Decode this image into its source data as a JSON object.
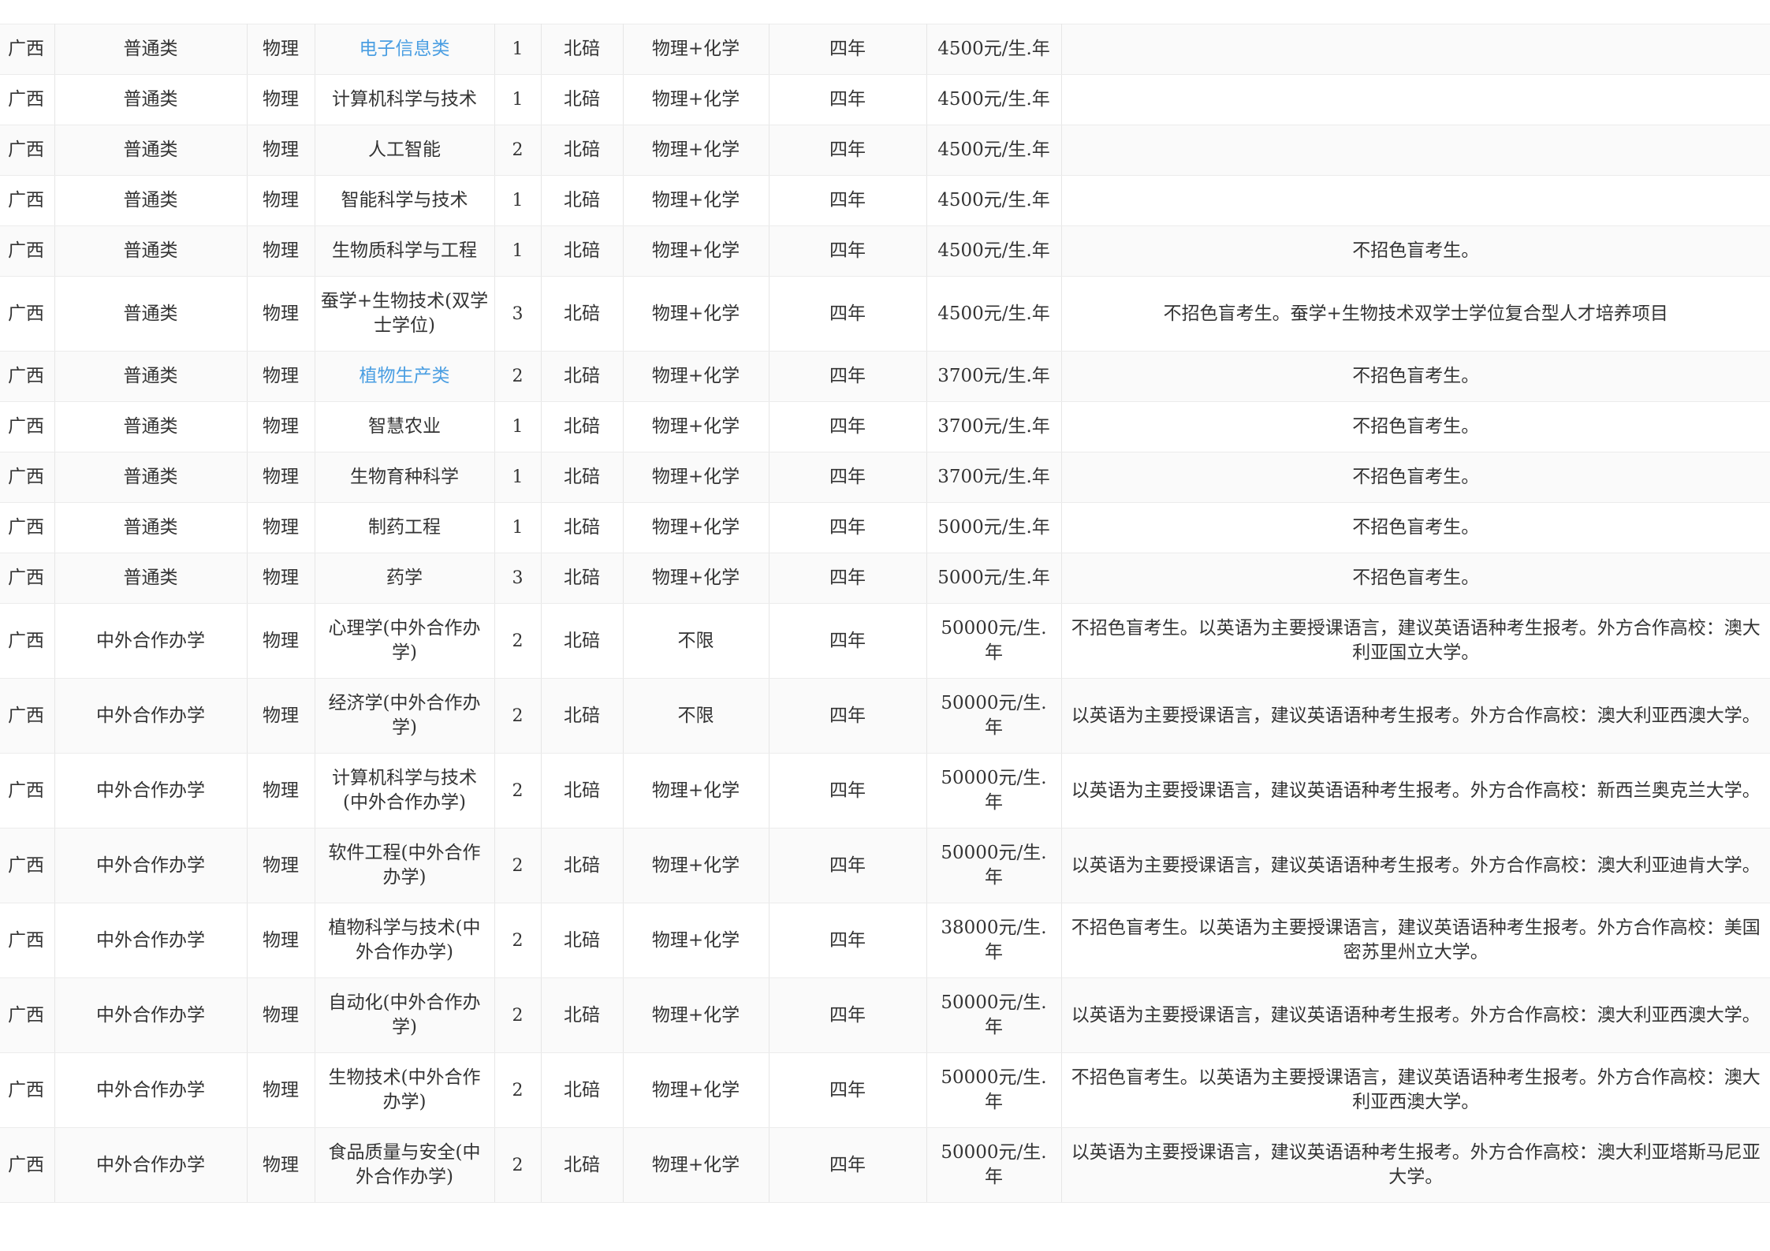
{
  "colors": {
    "link": "#4a9ee2",
    "text": "#333333",
    "row_alt": "#fafafa",
    "border": "#ececec"
  },
  "rows": [
    {
      "province": "广西",
      "type": "普通类",
      "subject": "物理",
      "major": "电子信息类",
      "major_link": true,
      "count": "1",
      "campus": "北碚",
      "req": "物理+化学",
      "years": "四年",
      "fee": "4500元/生.年",
      "note": ""
    },
    {
      "province": "广西",
      "type": "普通类",
      "subject": "物理",
      "major": "计算机科学与技术",
      "major_link": false,
      "count": "1",
      "campus": "北碚",
      "req": "物理+化学",
      "years": "四年",
      "fee": "4500元/生.年",
      "note": ""
    },
    {
      "province": "广西",
      "type": "普通类",
      "subject": "物理",
      "major": "人工智能",
      "major_link": false,
      "count": "2",
      "campus": "北碚",
      "req": "物理+化学",
      "years": "四年",
      "fee": "4500元/生.年",
      "note": ""
    },
    {
      "province": "广西",
      "type": "普通类",
      "subject": "物理",
      "major": "智能科学与技术",
      "major_link": false,
      "count": "1",
      "campus": "北碚",
      "req": "物理+化学",
      "years": "四年",
      "fee": "4500元/生.年",
      "note": ""
    },
    {
      "province": "广西",
      "type": "普通类",
      "subject": "物理",
      "major": "生物质科学与工程",
      "major_link": false,
      "count": "1",
      "campus": "北碚",
      "req": "物理+化学",
      "years": "四年",
      "fee": "4500元/生.年",
      "note": "不招色盲考生。"
    },
    {
      "province": "广西",
      "type": "普通类",
      "subject": "物理",
      "major": "蚕学+生物技术(双学士学位)",
      "major_link": false,
      "count": "3",
      "campus": "北碚",
      "req": "物理+化学",
      "years": "四年",
      "fee": "4500元/生.年",
      "note": "不招色盲考生。蚕学+生物技术双学士学位复合型人才培养项目",
      "tall": true
    },
    {
      "province": "广西",
      "type": "普通类",
      "subject": "物理",
      "major": "植物生产类",
      "major_link": true,
      "count": "2",
      "campus": "北碚",
      "req": "物理+化学",
      "years": "四年",
      "fee": "3700元/生.年",
      "note": "不招色盲考生。"
    },
    {
      "province": "广西",
      "type": "普通类",
      "subject": "物理",
      "major": "智慧农业",
      "major_link": false,
      "count": "1",
      "campus": "北碚",
      "req": "物理+化学",
      "years": "四年",
      "fee": "3700元/生.年",
      "note": "不招色盲考生。"
    },
    {
      "province": "广西",
      "type": "普通类",
      "subject": "物理",
      "major": "生物育种科学",
      "major_link": false,
      "count": "1",
      "campus": "北碚",
      "req": "物理+化学",
      "years": "四年",
      "fee": "3700元/生.年",
      "note": "不招色盲考生。"
    },
    {
      "province": "广西",
      "type": "普通类",
      "subject": "物理",
      "major": "制药工程",
      "major_link": false,
      "count": "1",
      "campus": "北碚",
      "req": "物理+化学",
      "years": "四年",
      "fee": "5000元/生.年",
      "note": "不招色盲考生。"
    },
    {
      "province": "广西",
      "type": "普通类",
      "subject": "物理",
      "major": "药学",
      "major_link": false,
      "count": "3",
      "campus": "北碚",
      "req": "物理+化学",
      "years": "四年",
      "fee": "5000元/生.年",
      "note": "不招色盲考生。"
    },
    {
      "province": "广西",
      "type": "中外合作办学",
      "subject": "物理",
      "major": "心理学(中外合作办学)",
      "major_link": false,
      "count": "2",
      "campus": "北碚",
      "req": "不限",
      "years": "四年",
      "fee": "50000元/生.年",
      "note": "不招色盲考生。以英语为主要授课语言，建议英语语种考生报考。外方合作高校：澳大利亚国立大学。",
      "tall": true
    },
    {
      "province": "广西",
      "type": "中外合作办学",
      "subject": "物理",
      "major": "经济学(中外合作办学)",
      "major_link": false,
      "count": "2",
      "campus": "北碚",
      "req": "不限",
      "years": "四年",
      "fee": "50000元/生.年",
      "note": "以英语为主要授课语言，建议英语语种考生报考。外方合作高校：澳大利亚西澳大学。",
      "tall": true
    },
    {
      "province": "广西",
      "type": "中外合作办学",
      "subject": "物理",
      "major": "计算机科学与技术(中外合作办学)",
      "major_link": false,
      "count": "2",
      "campus": "北碚",
      "req": "物理+化学",
      "years": "四年",
      "fee": "50000元/生.年",
      "note": "以英语为主要授课语言，建议英语语种考生报考。外方合作高校：新西兰奥克兰大学。",
      "tall": true
    },
    {
      "province": "广西",
      "type": "中外合作办学",
      "subject": "物理",
      "major": "软件工程(中外合作办学)",
      "major_link": false,
      "count": "2",
      "campus": "北碚",
      "req": "物理+化学",
      "years": "四年",
      "fee": "50000元/生.年",
      "note": "以英语为主要授课语言，建议英语语种考生报考。外方合作高校：澳大利亚迪肯大学。",
      "tall": true
    },
    {
      "province": "广西",
      "type": "中外合作办学",
      "subject": "物理",
      "major": "植物科学与技术(中外合作办学)",
      "major_link": false,
      "count": "2",
      "campus": "北碚",
      "req": "物理+化学",
      "years": "四年",
      "fee": "38000元/生.年",
      "note": "不招色盲考生。以英语为主要授课语言，建议英语语种考生报考。外方合作高校：美国密苏里州立大学。",
      "tall": true
    },
    {
      "province": "广西",
      "type": "中外合作办学",
      "subject": "物理",
      "major": "自动化(中外合作办学)",
      "major_link": false,
      "count": "2",
      "campus": "北碚",
      "req": "物理+化学",
      "years": "四年",
      "fee": "50000元/生.年",
      "note": "以英语为主要授课语言，建议英语语种考生报考。外方合作高校：澳大利亚西澳大学。",
      "tall": true
    },
    {
      "province": "广西",
      "type": "中外合作办学",
      "subject": "物理",
      "major": "生物技术(中外合作办学)",
      "major_link": false,
      "count": "2",
      "campus": "北碚",
      "req": "物理+化学",
      "years": "四年",
      "fee": "50000元/生.年",
      "note": "不招色盲考生。以英语为主要授课语言，建议英语语种考生报考。外方合作高校：澳大利亚西澳大学。",
      "tall": true
    },
    {
      "province": "广西",
      "type": "中外合作办学",
      "subject": "物理",
      "major": "食品质量与安全(中外合作办学)",
      "major_link": false,
      "count": "2",
      "campus": "北碚",
      "req": "物理+化学",
      "years": "四年",
      "fee": "50000元/生.年",
      "note": "以英语为主要授课语言，建议英语语种考生报考。外方合作高校：澳大利亚塔斯马尼亚大学。",
      "tall": true
    }
  ]
}
